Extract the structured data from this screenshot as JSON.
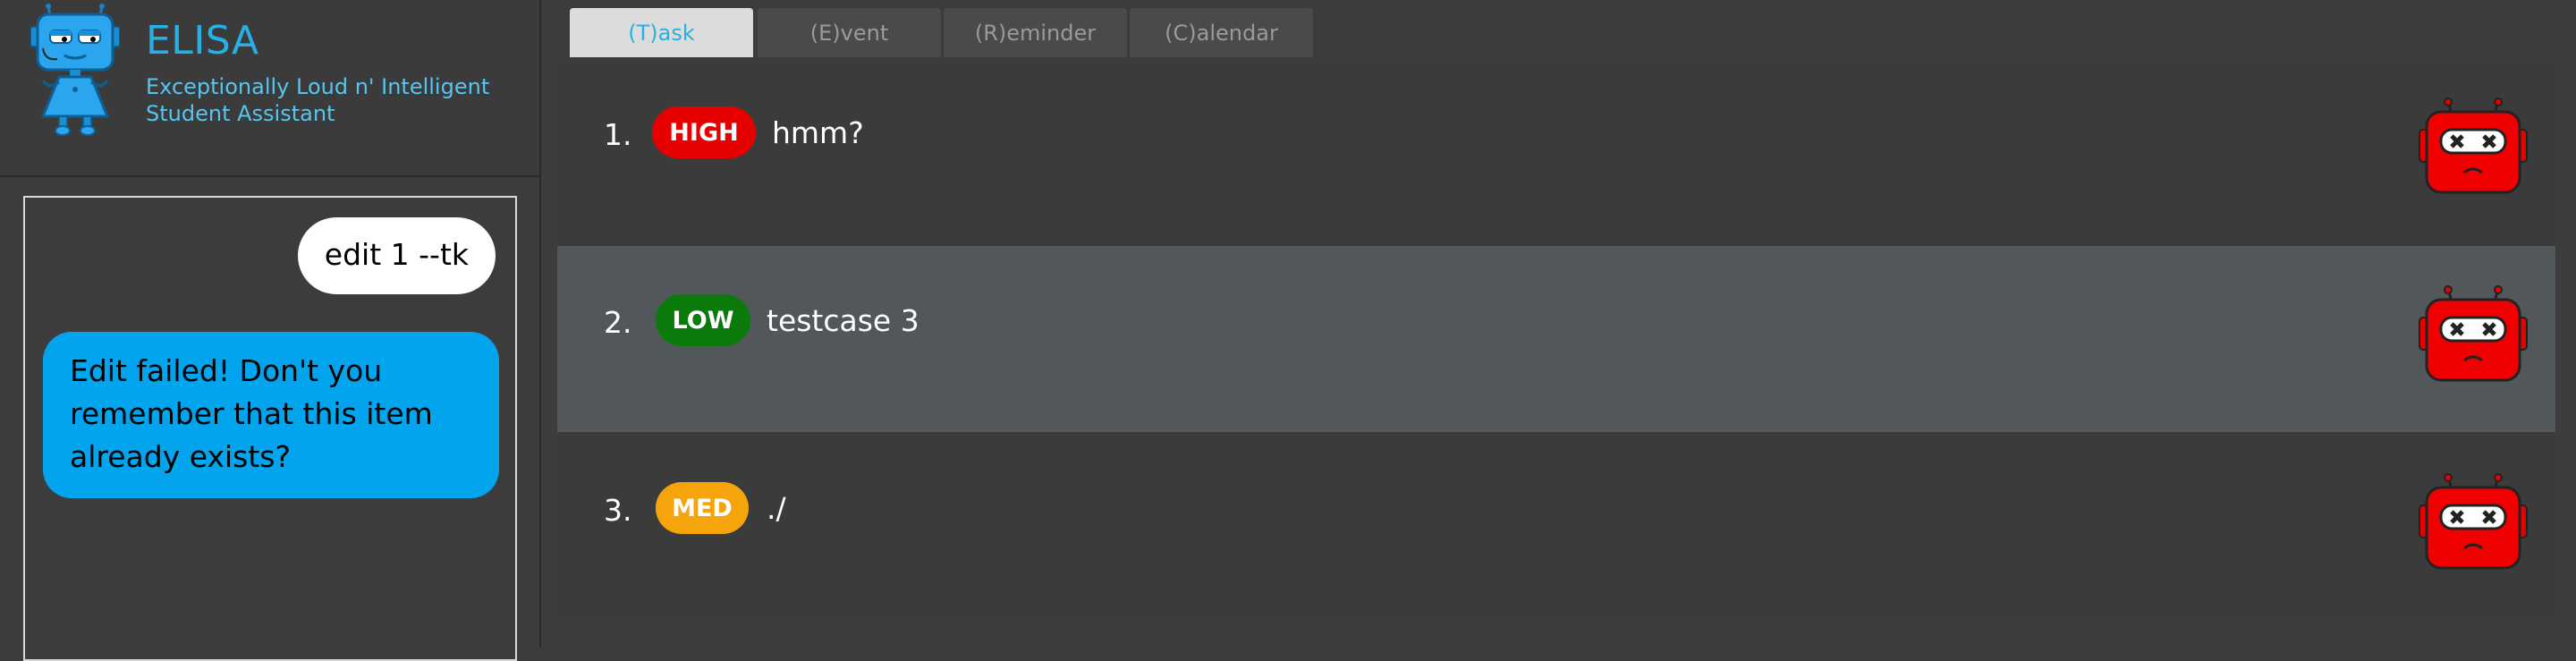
{
  "app": {
    "title": "ELISA",
    "subtitle": "Exceptionally Loud n' Intelligent Student Assistant"
  },
  "chat": {
    "messages": [
      {
        "sender": "user",
        "text": "edit 1 --tk"
      },
      {
        "sender": "elisa",
        "text": "Edit failed! Don't you remember that this item already exists?"
      }
    ]
  },
  "tabs": [
    {
      "label": "(T)ask",
      "active": true
    },
    {
      "label": "(E)vent",
      "active": false
    },
    {
      "label": "(R)eminder",
      "active": false
    },
    {
      "label": "(C)alendar",
      "active": false
    }
  ],
  "tasks": [
    {
      "index": "1.",
      "priority": "HIGH",
      "description": "hmm?",
      "status_icon": "robot-dead-icon"
    },
    {
      "index": "2.",
      "priority": "LOW",
      "description": "testcase 3",
      "status_icon": "robot-dead-icon"
    },
    {
      "index": "3.",
      "priority": "MED",
      "description": "./",
      "status_icon": "robot-dead-icon"
    }
  ],
  "colors": {
    "accent": "#25b0e6",
    "priority_high": "#e60000",
    "priority_low": "#0a7a0a",
    "priority_med": "#f5a40b",
    "user_bubble": "#ffffff",
    "elisa_bubble": "#03a4ee",
    "selected_row": "#525759"
  }
}
